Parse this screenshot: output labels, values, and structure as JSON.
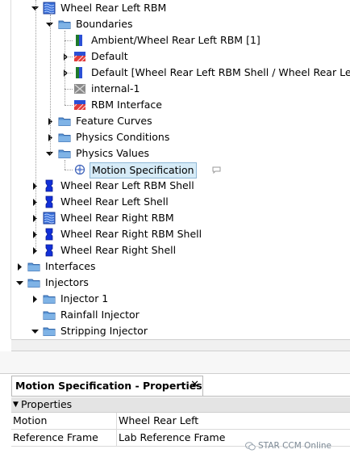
{
  "tree": [
    {
      "label": "Wheel Rear Left RBM",
      "icon": "rbm-region-icon",
      "expand": "expanded"
    },
    {
      "label": "Boundaries",
      "icon": "folder-icon",
      "expand": "expanded"
    },
    {
      "label": "Ambient/Wheel Rear Left RBM [1]",
      "icon": "interface-boundary-icon",
      "expand": "none"
    },
    {
      "label": "Default",
      "icon": "wall-boundary-icon",
      "expand": "collapsed"
    },
    {
      "label": "Default [Wheel Rear Left RBM Shell / Wheel Rear Left RBM]",
      "icon": "interface-boundary-icon",
      "expand": "collapsed"
    },
    {
      "label": "internal-1",
      "icon": "internal-boundary-icon",
      "expand": "none"
    },
    {
      "label": "RBM Interface",
      "icon": "wall-boundary-icon",
      "expand": "none"
    },
    {
      "label": "Feature Curves",
      "icon": "folder-icon",
      "expand": "collapsed"
    },
    {
      "label": "Physics Conditions",
      "icon": "folder-icon",
      "expand": "collapsed"
    },
    {
      "label": "Physics Values",
      "icon": "folder-icon",
      "expand": "expanded"
    },
    {
      "label": "Motion Specification",
      "icon": "motion-specification-icon",
      "expand": "none",
      "selected": true
    },
    {
      "label": "Wheel Rear Left RBM Shell",
      "icon": "shell-region-icon",
      "expand": "collapsed"
    },
    {
      "label": "Wheel Rear Left Shell",
      "icon": "shell-region-icon",
      "expand": "collapsed"
    },
    {
      "label": "Wheel Rear Right RBM",
      "icon": "rbm-region-icon",
      "expand": "collapsed"
    },
    {
      "label": "Wheel Rear Right RBM Shell",
      "icon": "shell-region-icon",
      "expand": "collapsed"
    },
    {
      "label": "Wheel Rear Right Shell",
      "icon": "shell-region-icon",
      "expand": "collapsed"
    },
    {
      "label": "Interfaces",
      "icon": "folder-icon",
      "expand": "collapsed"
    },
    {
      "label": "Injectors",
      "icon": "folder-icon",
      "expand": "expanded"
    },
    {
      "label": "Injector 1",
      "icon": "folder-icon",
      "expand": "collapsed"
    },
    {
      "label": "Rainfall Injector",
      "icon": "folder-icon",
      "expand": "none"
    },
    {
      "label": "Stripping Injector",
      "icon": "folder-icon",
      "expand": "expanded"
    }
  ],
  "properties_panel": {
    "tab_title": "Motion Specification - Properties",
    "close_glyph": "✕",
    "category": "Properties",
    "category_glyph": "▼",
    "rows": [
      {
        "name": "Motion",
        "value": "Wheel Rear Left"
      },
      {
        "name": "Reference Frame",
        "value": "Lab Reference Frame"
      }
    ]
  },
  "watermark": "STAR CCM Online"
}
